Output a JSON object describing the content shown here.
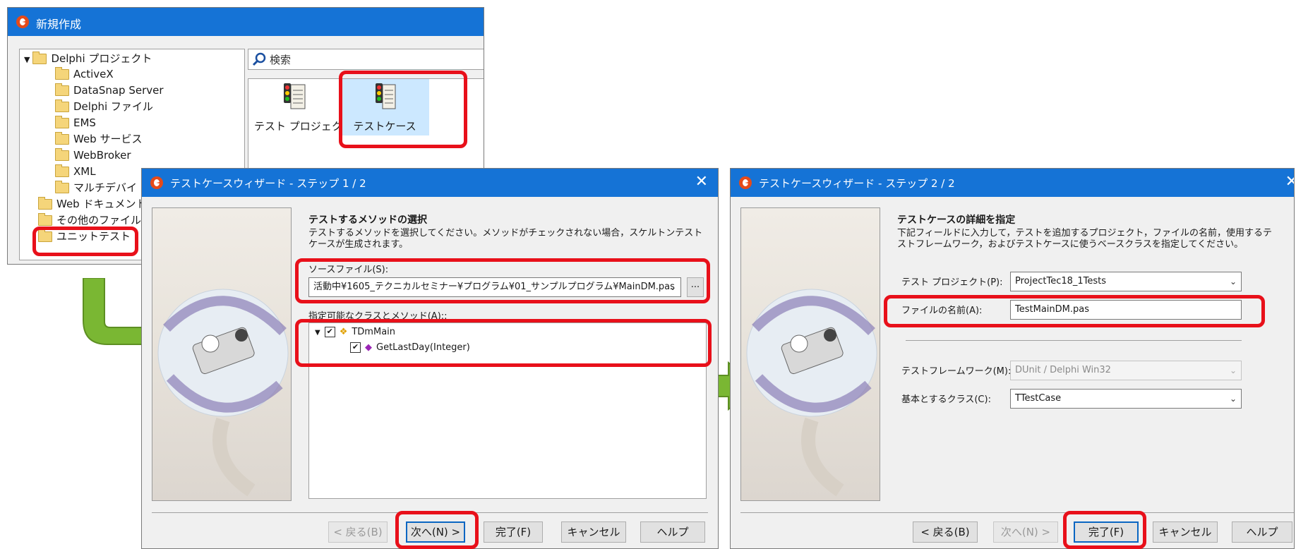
{
  "new_dialog": {
    "title": "新規作成",
    "search_placeholder": "検索",
    "tree": [
      "Delphi プロジェクト",
      "ActiveX",
      "DataSnap Server",
      "Delphi ファイル",
      "EMS",
      "Web サービス",
      "WebBroker",
      "XML",
      "マルチデバイ",
      "Web ドキュメント",
      "その他のファイル",
      "ユニットテスト"
    ],
    "items": [
      "テスト プロジェクト",
      "テストケース"
    ]
  },
  "wizard1": {
    "title": "テストケースウィザード - ステップ 1 / 2",
    "heading": "テストするメソッドの選択",
    "description": "テストするメソッドを選択してください。メソッドがチェックされない場合，スケルトンテストケースが生成されます。",
    "source_label": "ソースファイル(S):",
    "source_value": "活動中¥1605_テクニカルセミナー¥プログラム¥01_サンプルプログラム¥MainDM.pas",
    "browse_label": "...",
    "classes_label": "指定可能なクラスとメソッド(A)::",
    "tree": [
      "TDmMain",
      "GetLastDay(Integer)"
    ],
    "buttons": {
      "back": "< 戻る(B)",
      "next": "次へ(N) >",
      "finish": "完了(F)",
      "cancel": "キャンセル",
      "help": "ヘルプ"
    }
  },
  "wizard2": {
    "title": "テストケースウィザード - ステップ 2 / 2",
    "heading": "テストケースの詳細を指定",
    "description": "下記フィールドに入力して，テストを追加するプロジェクト，ファイルの名前，使用するテストフレームワーク，およびテストケースに使うベースクラスを指定してください。",
    "fields": {
      "project_label": "テスト プロジェクト(P):",
      "project_value": "ProjectTec18_1Tests",
      "filename_label": "ファイルの名前(A):",
      "filename_value": "TestMainDM.pas",
      "framework_label": "テストフレームワーク(M):",
      "framework_value": "DUnit / Delphi Win32",
      "baseclass_label": "基本とするクラス(C):",
      "baseclass_value": "TTestCase"
    },
    "buttons": {
      "back": "< 戻る(B)",
      "next": "次へ(N) >",
      "finish": "完了(F)",
      "cancel": "キャンセル",
      "help": "ヘルプ"
    }
  },
  "colors": {
    "titlebar": "#1573d6",
    "highlight_red": "#e8101a",
    "arrow_green": "#7ab733",
    "selected_item": "#cce8ff"
  }
}
